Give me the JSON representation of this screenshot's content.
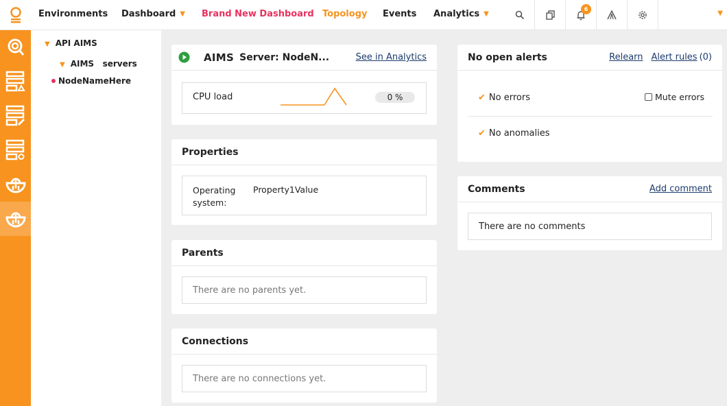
{
  "nav": {
    "items": [
      {
        "label": "Environments"
      },
      {
        "label": "Dashboard"
      },
      {
        "label": "Brand New Dashboard"
      },
      {
        "label": "Topology"
      },
      {
        "label": "Events"
      },
      {
        "label": "Analytics"
      }
    ],
    "notifications_count": "6"
  },
  "tree": {
    "root": "API AIMS",
    "child_prefix": "AIMS",
    "child_label": "servers",
    "leaf": "NodeNameHere"
  },
  "server": {
    "prefix": "AIMS",
    "title": "Server: NodeN...",
    "analytics_link": "See in Analytics",
    "cpu_label": "CPU load",
    "cpu_value": "0 %"
  },
  "properties": {
    "title": "Properties",
    "key": "Operating system:",
    "value": "Property1Value"
  },
  "parents": {
    "title": "Parents",
    "empty": "There are no parents yet."
  },
  "connections": {
    "title": "Connections",
    "empty": "There are no connections yet."
  },
  "alerts": {
    "title": "No open alerts",
    "relearn": "Relearn",
    "rules": "Alert rules",
    "rules_count": "(0)",
    "no_errors": "No errors",
    "mute": "Mute errors",
    "no_anomalies": "No anomalies"
  },
  "comments": {
    "title": "Comments",
    "add": "Add comment",
    "empty": "There are no comments"
  },
  "colors": {
    "accent": "#f7931e",
    "brand_red": "#e8315e",
    "link": "#1b3a6b",
    "play_green": "#2e9e3e"
  }
}
